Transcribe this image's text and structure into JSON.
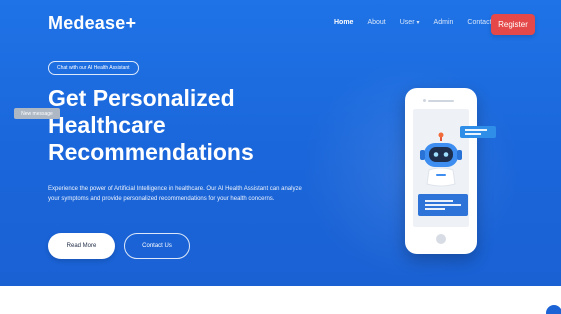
{
  "brand": {
    "name": "Medease+"
  },
  "nav": {
    "items": [
      {
        "label": "Home",
        "active": true
      },
      {
        "label": "About",
        "active": false
      },
      {
        "label": "User",
        "active": false,
        "has_dropdown": true
      },
      {
        "label": "Admin",
        "active": false
      },
      {
        "label": "Contact",
        "active": false
      }
    ],
    "register_label": "Register"
  },
  "hero": {
    "badge": "Chat with our AI Health Assistant",
    "headline": [
      "Get Personalized",
      "Healthcare",
      "Recommendations"
    ],
    "description": "Experience the power of Artificial Intelligence in healthcare. Our AI Health Assistant can analyze your symptoms and provide personalized recommendations for your health concerns.",
    "read_more_label": "Read More",
    "contact_label": "Contact Us"
  },
  "illustration": {
    "message_banner": "New message",
    "icons": [
      "phone-illustration",
      "robot-icon",
      "chat-bubble-icon"
    ]
  },
  "colors": {
    "hero_background": "#1a66da",
    "register_button": "#e54848",
    "text_on_hero": "#ffffff"
  }
}
